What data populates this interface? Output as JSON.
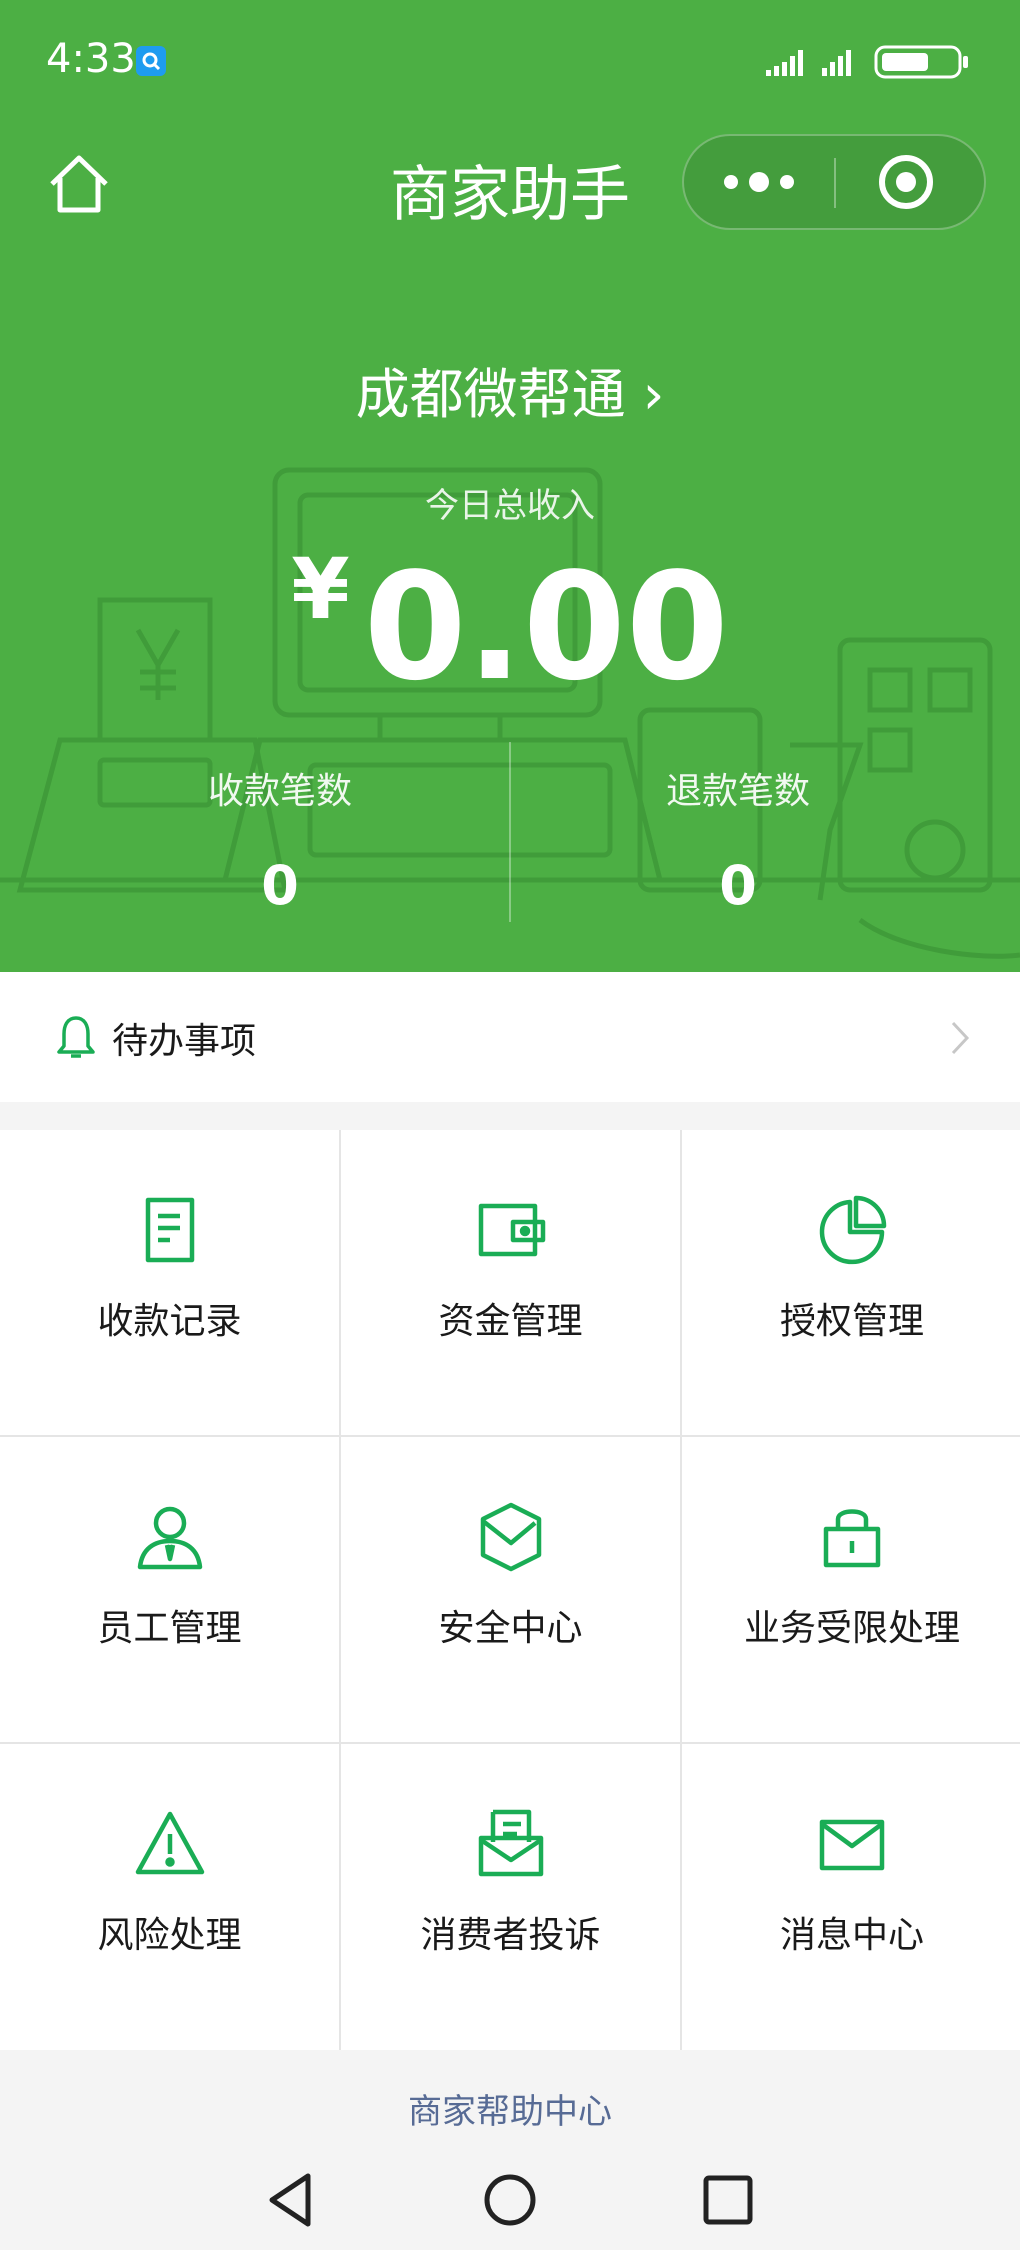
{
  "status_bar": {
    "time": "4:33"
  },
  "nav": {
    "title": "商家助手"
  },
  "store": {
    "name": "成都微帮通 ›"
  },
  "income": {
    "label": "今日总收入",
    "currency": "¥",
    "amount": "0.00"
  },
  "stats": [
    {
      "label": "收款笔数",
      "value": "0"
    },
    {
      "label": "退款笔数",
      "value": "0"
    }
  ],
  "todo": {
    "label": "待办事项"
  },
  "menu": [
    {
      "label": "收款记录",
      "icon": "receipt-icon"
    },
    {
      "label": "资金管理",
      "icon": "wallet-icon"
    },
    {
      "label": "授权管理",
      "icon": "pie-chart-icon"
    },
    {
      "label": "员工管理",
      "icon": "staff-icon"
    },
    {
      "label": "安全中心",
      "icon": "shield-icon"
    },
    {
      "label": "业务受限处理",
      "icon": "lock-icon"
    },
    {
      "label": "风险处理",
      "icon": "warning-icon"
    },
    {
      "label": "消费者投诉",
      "icon": "complaint-mail-icon"
    },
    {
      "label": "消息中心",
      "icon": "envelope-icon"
    }
  ],
  "help": {
    "label": "商家帮助中心"
  },
  "colors": {
    "brand_green": "#4caf44",
    "icon_green": "#1aad55",
    "link_blue": "#576b95"
  }
}
